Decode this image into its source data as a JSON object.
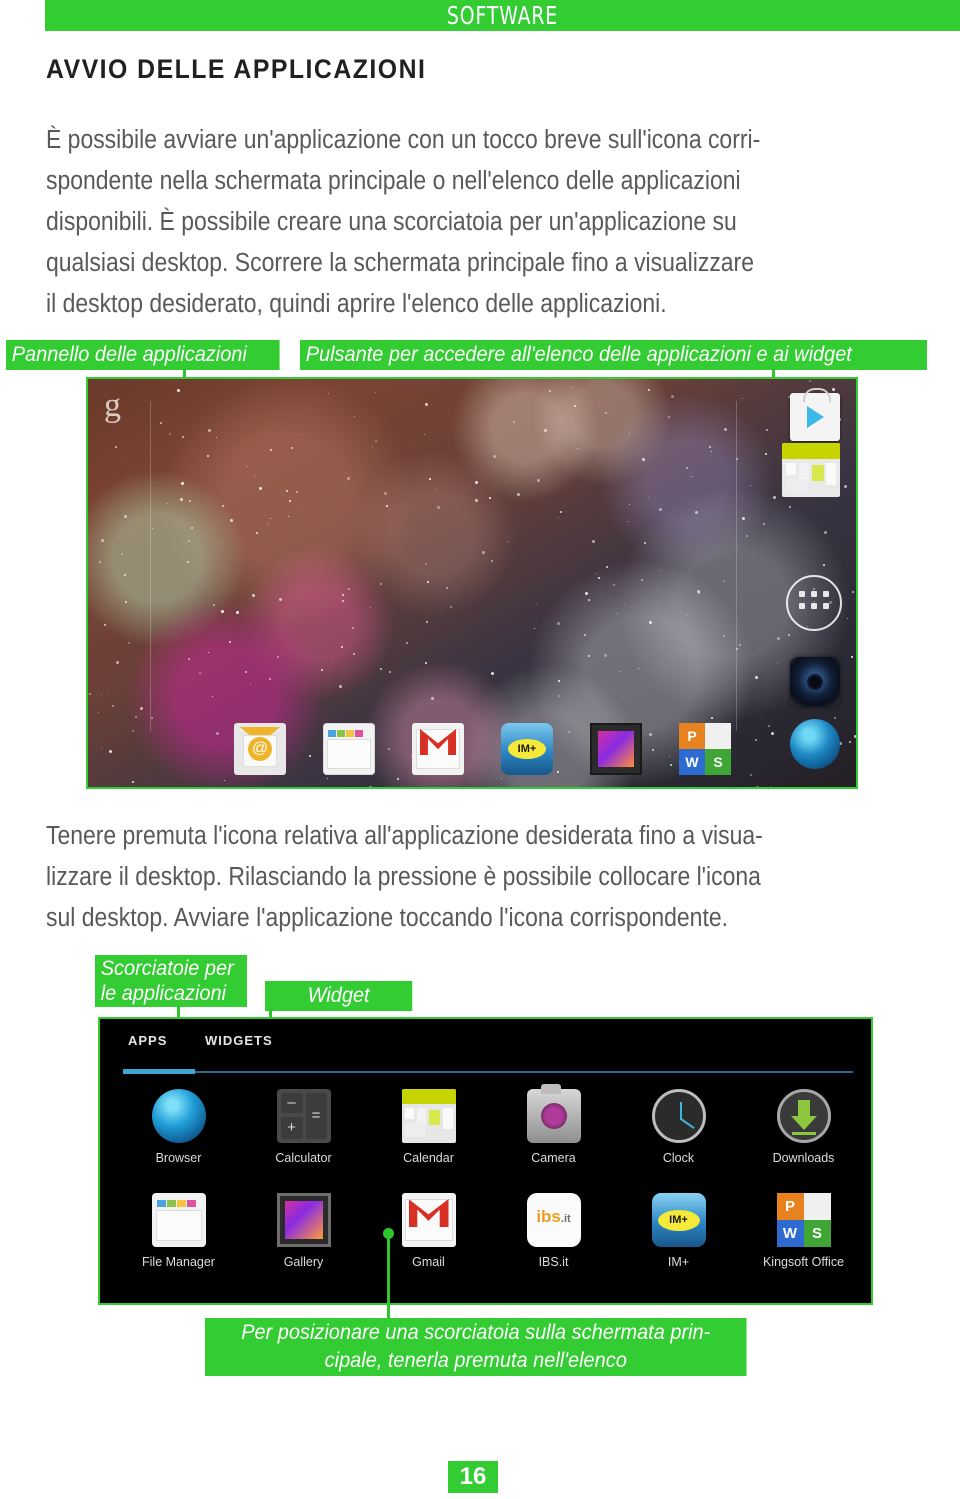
{
  "header": {
    "section_label": "SOFTWARE",
    "page_title": "AVVIO DELLE APPLICAZIONI"
  },
  "paragraphs": {
    "intro": [
      "È possibile avviare un'applicazione con un tocco breve sull'icona corri-",
      "spondente nella schermata principale o nell'elenco delle applicazioni",
      "disponibili. È possibile creare una scorciatoia per un'applicazione su",
      "qualsiasi desktop. Scorrere la schermata principale fino a visualizzare",
      "il desktop desiderato, quindi aprire l'elenco delle applicazioni."
    ],
    "middle": [
      "Tenere premuta l'icona relativa all'applicazione desiderata fino a visua-",
      "lizzare il desktop. Rilasciando la pressione è possibile collocare l'icona",
      "sul desktop. Avviare l'applicazione toccando l'icona corrispondente."
    ]
  },
  "callouts": {
    "panel": "Pannello delle applicazioni",
    "drawer_button": "Pulsante per accedere all'elenco delle applicazioni e ai widget",
    "shortcuts": "Scorciatoie per le applicazioni",
    "widget": "Widget",
    "bottom_note": "Per posizionare una scorciatoia sulla schermata prin-cipale, tenerla premuta nell'elenco"
  },
  "home_screen": {
    "search_logo": "g",
    "dock_icons": [
      "email-icon",
      "file-manager-icon",
      "gmail-icon",
      "im-plus-icon",
      "gallery-icon",
      "kingsoft-office-icon",
      "browser-icon"
    ],
    "right_column": [
      "play-store-icon",
      "calendar-widget",
      "app-drawer-button",
      "speaker-icon",
      "browser-globe-icon"
    ]
  },
  "app_drawer": {
    "tabs": [
      {
        "label": "APPS",
        "active": true
      },
      {
        "label": "WIDGETS",
        "active": false
      }
    ],
    "rows": [
      [
        {
          "label": "Browser",
          "icon": "browser-globe-icon"
        },
        {
          "label": "Calculator",
          "icon": "calculator-icon"
        },
        {
          "label": "Calendar",
          "icon": "calendar-icon"
        },
        {
          "label": "Camera",
          "icon": "camera-icon"
        },
        {
          "label": "Clock",
          "icon": "clock-icon"
        },
        {
          "label": "Downloads",
          "icon": "downloads-icon"
        }
      ],
      [
        {
          "label": "File Manager",
          "icon": "file-manager-icon"
        },
        {
          "label": "Gallery",
          "icon": "gallery-icon"
        },
        {
          "label": "Gmail",
          "icon": "gmail-icon"
        },
        {
          "label": "IBS.it",
          "icon": "ibs-it-icon"
        },
        {
          "label": "IM+",
          "icon": "im-plus-icon"
        },
        {
          "label": "Kingsoft Office",
          "icon": "kingsoft-office-icon"
        }
      ]
    ]
  },
  "footer": {
    "page_number": "16"
  },
  "colors": {
    "brand_green": "#33cc33",
    "line_green": "#2fc52f",
    "body_text": "#58595b",
    "title_text": "#231f20"
  }
}
